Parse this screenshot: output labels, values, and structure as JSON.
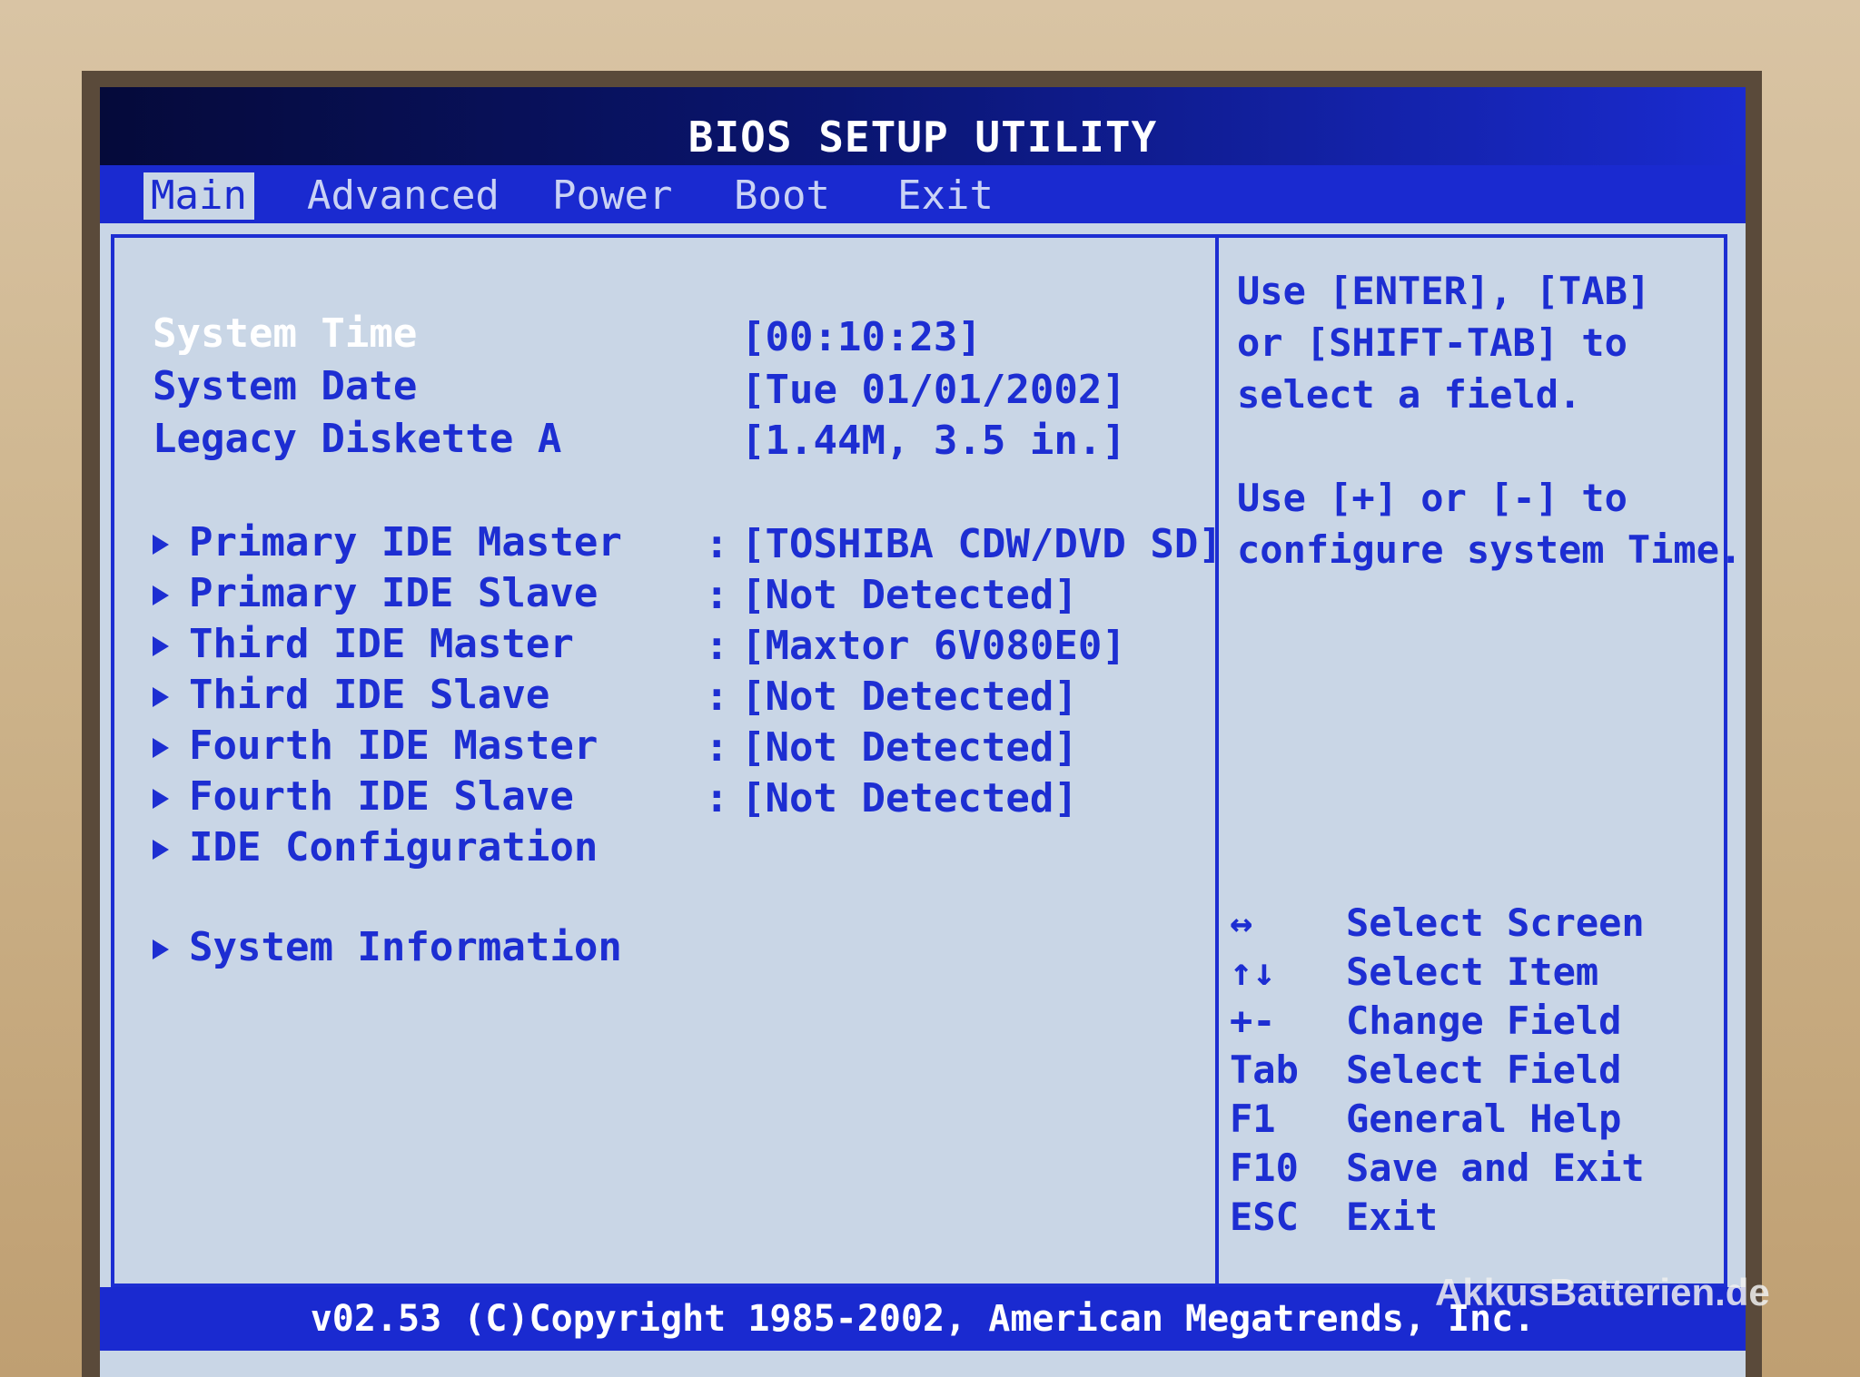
{
  "title": "BIOS SETUP UTILITY",
  "tabs": [
    {
      "label": "Main",
      "active": true
    },
    {
      "label": "Advanced"
    },
    {
      "label": "Power"
    },
    {
      "label": "Boot"
    },
    {
      "label": "Exit"
    }
  ],
  "settings": [
    {
      "label": "System Time",
      "value": "[00:10:23]"
    },
    {
      "label": "System Date",
      "value": "[Tue 01/01/2002]"
    },
    {
      "label": "Legacy Diskette A",
      "value": "[1.44M, 3.5 in.]"
    }
  ],
  "submenus": [
    {
      "label": "Primary IDE Master",
      "value": "[TOSHIBA CDW/DVD SD]"
    },
    {
      "label": "Primary IDE Slave",
      "value": "[Not Detected]"
    },
    {
      "label": "Third IDE Master",
      "value": "[Maxtor 6V080E0]"
    },
    {
      "label": "Third IDE Slave",
      "value": "[Not Detected]"
    },
    {
      "label": "Fourth IDE Master",
      "value": "[Not Detected]"
    },
    {
      "label": "Fourth IDE Slave",
      "value": "[Not Detected]"
    },
    {
      "label": "IDE Configuration"
    },
    {
      "label": "System Information"
    }
  ],
  "help": {
    "lines": [
      "Use [ENTER], [TAB]",
      "or [SHIFT-TAB] to",
      "select a field.",
      "",
      "Use [+] or [-] to",
      "configure system Time."
    ]
  },
  "keys": [
    {
      "key": "↔",
      "desc": "Select Screen"
    },
    {
      "key": "↑↓",
      "desc": "Select Item"
    },
    {
      "key": "+-",
      "desc": "Change Field"
    },
    {
      "key": "Tab",
      "desc": "Select Field"
    },
    {
      "key": "F1",
      "desc": "General Help"
    },
    {
      "key": "F10",
      "desc": "Save and Exit"
    },
    {
      "key": "ESC",
      "desc": "Exit"
    }
  ],
  "footer": "v02.53 (C)Copyright 1985-2002, American Megatrends, Inc.",
  "watermark": "AkkusBatterien.de",
  "colors": {
    "bios_blue": "#1d2ed2",
    "screen_bg": "#c9d6e6",
    "title_dark": "#050a3a"
  }
}
